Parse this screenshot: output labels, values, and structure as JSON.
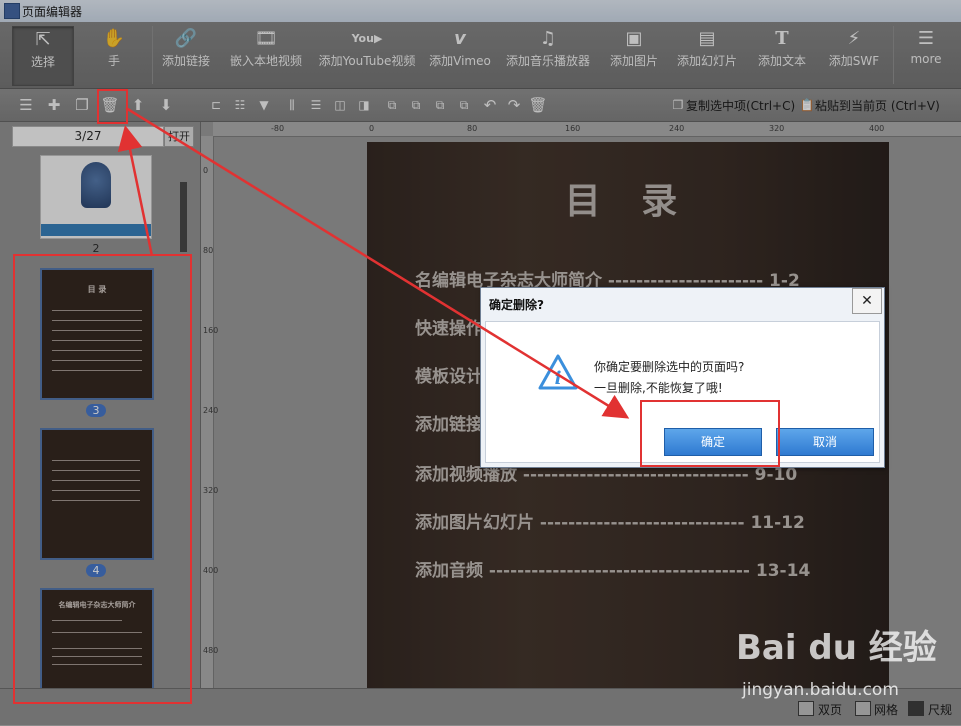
{
  "window": {
    "title": "页面编辑器"
  },
  "toolbar": {
    "items": [
      {
        "label": "选择",
        "icon": "select-cursor-icon"
      },
      {
        "label": "手",
        "icon": "hand-icon"
      },
      {
        "label": "添加链接",
        "icon": "link-icon"
      },
      {
        "label": "嵌入本地视频",
        "icon": "film-icon"
      },
      {
        "label": "添加YouTube视频",
        "icon": "youtube-icon"
      },
      {
        "label": "添加Vimeo",
        "icon": "vimeo-icon"
      },
      {
        "label": "添加音乐播放器",
        "icon": "music-note-icon"
      },
      {
        "label": "添加图片",
        "icon": "image-icon"
      },
      {
        "label": "添加幻灯片",
        "icon": "slideshow-icon"
      },
      {
        "label": "添加文本",
        "icon": "text-t-icon"
      },
      {
        "label": "添加SWF",
        "icon": "flash-icon"
      },
      {
        "label": "more",
        "icon": "more-list-icon"
      }
    ]
  },
  "toolbar2": {
    "copy_label": "复制选中项(Ctrl+C)",
    "paste_label": "粘贴到当前页 (Ctrl+V)"
  },
  "pages": {
    "indicator": "3/27",
    "open_label": "打开",
    "thumb_labels": [
      "2",
      "3",
      "4"
    ],
    "thumb3_title": "目 录",
    "thumb5_title": "名编辑电子杂志大师简介"
  },
  "ruler": {
    "h_ticks": [
      "-80",
      "0",
      "80",
      "160",
      "240",
      "320",
      "400"
    ],
    "v_ticks": [
      "0",
      "80",
      "160",
      "240",
      "320",
      "400",
      "480"
    ]
  },
  "canvas": {
    "title": "目 录",
    "toc": [
      "名编辑电子杂志大师简介 ---------------------- 1-2",
      "快速操作",
      "模板设计",
      "添加链接",
      "添加视频播放 -------------------------------- 9-10",
      "添加图片幻灯片 ----------------------------- 11-12",
      "添加音频 ------------------------------------- 13-14"
    ]
  },
  "dialog": {
    "title": "确定删除?",
    "close_glyph": "✕",
    "message_line1": "你确定要删除选中的页面吗?",
    "message_line2": "一旦删除,不能恢复了哦!",
    "confirm_label": "确定",
    "cancel_label": "取消"
  },
  "statusbar": {
    "double_label": "双页",
    "grid_label": "网格",
    "ruler_label": "尺规"
  },
  "watermark": {
    "brand": "Bai du 经验",
    "url": "jingyan.baidu.com"
  },
  "colors": {
    "annotation_red": "#e13232",
    "dialog_button_blue": "#2f7ad1",
    "page_dark": "#2f221b"
  }
}
